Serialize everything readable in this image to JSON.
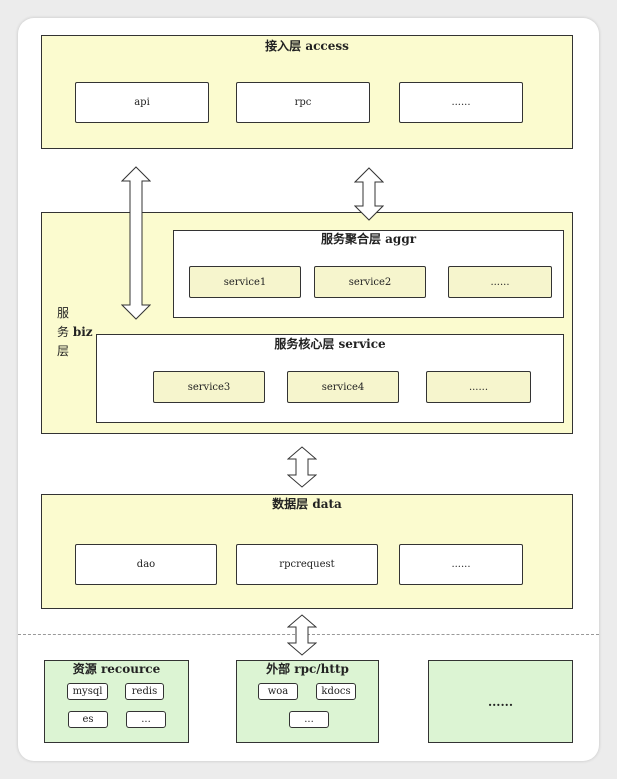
{
  "access": {
    "title": "接入层 access",
    "items": [
      "api",
      "rpc",
      "......"
    ]
  },
  "biz": {
    "title_line1": "服",
    "title_line2_a": "务",
    "title_line2_b": "biz",
    "title_line3": "层"
  },
  "aggr": {
    "title": "服务聚合层 aggr",
    "items": [
      "service1",
      "service2",
      "......"
    ]
  },
  "service": {
    "title": "服务核心层 service",
    "items": [
      "service3",
      "service4",
      "......"
    ]
  },
  "data": {
    "title": "数据层 data",
    "items": [
      "dao",
      "rpcrequest",
      "......"
    ]
  },
  "resource": {
    "title": "资源 recource",
    "items": [
      "mysql",
      "redis",
      "es",
      "..."
    ]
  },
  "external": {
    "title": "外部 rpc/http",
    "items": [
      "woa",
      "kdocs",
      "..."
    ]
  },
  "other": {
    "label": "......"
  }
}
